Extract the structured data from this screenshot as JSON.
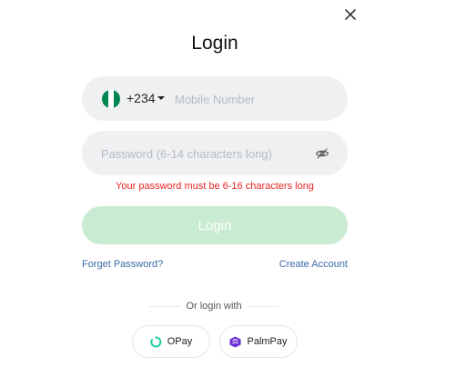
{
  "title": "Login",
  "phone": {
    "country_code": "+234",
    "placeholder": "Mobile Number",
    "flag_colors": [
      "#008751",
      "#ffffff",
      "#008751"
    ]
  },
  "password": {
    "placeholder": "Password (6-14 characters long)",
    "error": "Your password must be 6-16 characters long"
  },
  "login_button": "Login",
  "links": {
    "forget": "Forget Password?",
    "create": "Create Account"
  },
  "divider_text": "Or login with",
  "providers": [
    {
      "label": "OPay",
      "icon": "opay-icon"
    },
    {
      "label": "PalmPay",
      "icon": "palmpay-icon"
    }
  ],
  "colors": {
    "error": "#e52626",
    "login_disabled": "#c9ebd1",
    "link": "#3a6aa8",
    "opay": "#1dcf9f",
    "palmpay": "#6d2ed4"
  }
}
